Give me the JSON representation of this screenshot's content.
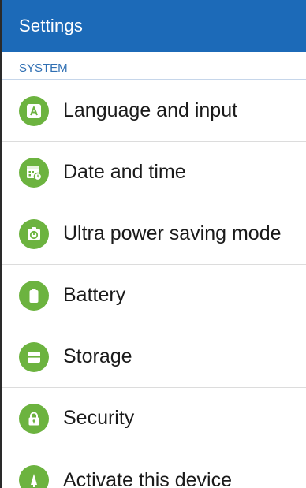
{
  "app": {
    "title": "Settings"
  },
  "section": {
    "header": "SYSTEM"
  },
  "items": [
    {
      "label": "Language and input",
      "icon": "language-icon"
    },
    {
      "label": "Date and time",
      "icon": "calendar-clock-icon"
    },
    {
      "label": "Ultra power saving mode",
      "icon": "power-saving-icon"
    },
    {
      "label": "Battery",
      "icon": "battery-icon"
    },
    {
      "label": "Storage",
      "icon": "storage-icon"
    },
    {
      "label": "Security",
      "icon": "lock-icon"
    },
    {
      "label": "Activate this device",
      "icon": "activate-device-icon"
    }
  ],
  "colors": {
    "action_bar": "#1c6ab8",
    "section_header": "#2f6fb3",
    "icon_green": "#6cb33f"
  }
}
